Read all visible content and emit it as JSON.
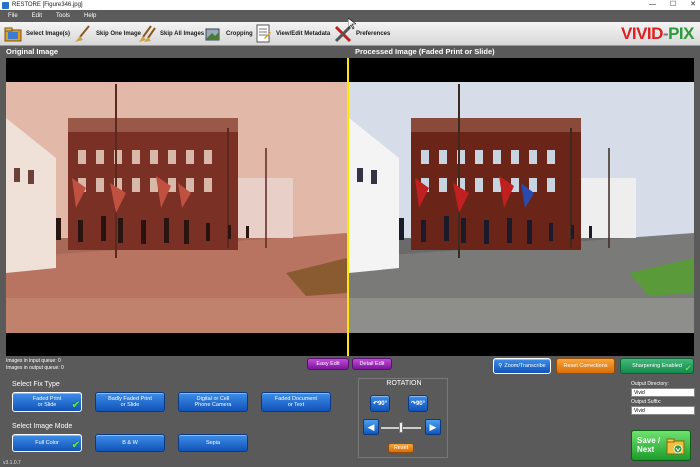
{
  "window": {
    "title": "RESTORE [Figure346.jpg]",
    "controls": [
      "—",
      "☐",
      "✕"
    ]
  },
  "menu": [
    "File",
    "Edit",
    "Tools",
    "Help"
  ],
  "toolbar": {
    "items": [
      {
        "label": "Select Image(s)",
        "icon": "folder-icon"
      },
      {
        "label": "Skip One Image",
        "icon": "broom-icon"
      },
      {
        "label": "Skip All Images",
        "icon": "brooms-icon"
      },
      {
        "label": "Cropping",
        "icon": "crop-icon"
      },
      {
        "label": "View/Edit Metadata",
        "icon": "document-icon"
      },
      {
        "label": "Preferences",
        "icon": "tools-icon"
      }
    ]
  },
  "logo": {
    "part1": "VIVID",
    "sep": "-",
    "part2": "PIX",
    "color1": "#e02020",
    "color2": "#2a9a3a"
  },
  "panels": {
    "original": "Original Image",
    "processed": "Processed Image (Faded Print or Slide)"
  },
  "queue": {
    "input": "Images in input queue:  0",
    "output": "Images in output queue:  0"
  },
  "edit_buttons": {
    "easy": "Easy Edit",
    "detail": "Detail Edit"
  },
  "right_buttons": {
    "zoom": "Zoom/Transcribe",
    "reset": "Reset Corrections",
    "sharpen": "Sharpening Enabled"
  },
  "fix_type": {
    "label": "Select Fix Type",
    "options": [
      {
        "label": "Faded Print\nor Slide",
        "selected": true
      },
      {
        "label": "Badly Faded Print\nor Slide",
        "selected": false
      },
      {
        "label": "Digital or Cell\nPhone Camera",
        "selected": false
      },
      {
        "label": "Faded Document\nor Text",
        "selected": false
      }
    ]
  },
  "image_mode": {
    "label": "Select Image Mode",
    "options": [
      {
        "label": "Full Color",
        "selected": true
      },
      {
        "label": "B & W",
        "selected": false
      },
      {
        "label": "Sepia",
        "selected": false
      }
    ]
  },
  "rotation": {
    "label": "ROTATION",
    "ccw": "90°",
    "cw": "90°",
    "reset": "Reset"
  },
  "output": {
    "dir_label": "Output Directory:",
    "dir_value": "Vivid",
    "suffix_label": "Output Suffix:",
    "suffix_value": "Vivid"
  },
  "save": {
    "line1": "Save /",
    "line2": "Next"
  },
  "version": "v3.1.0.7"
}
